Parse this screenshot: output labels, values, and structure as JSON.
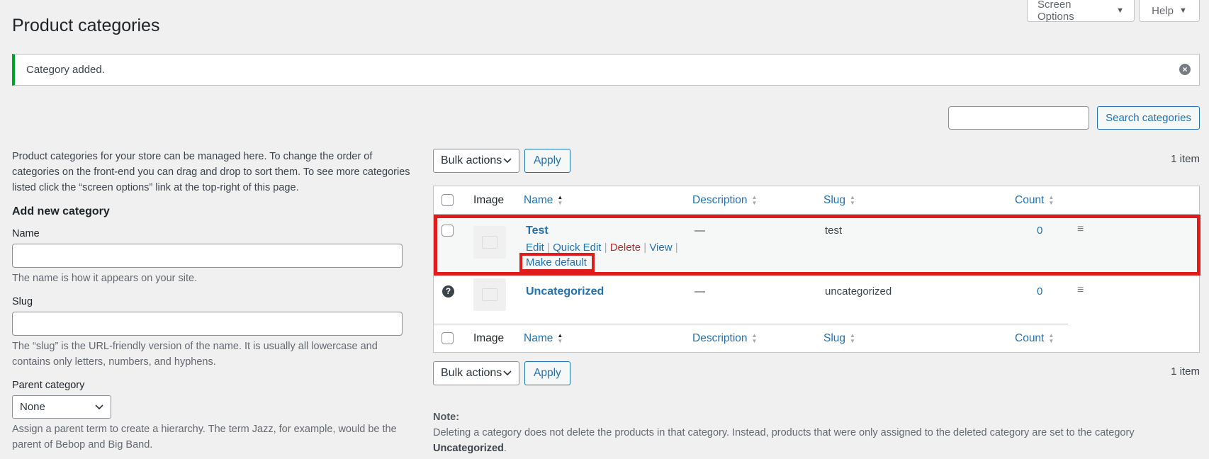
{
  "screen_options": {
    "label": "Screen Options",
    "caret": "▼"
  },
  "help": {
    "label": "Help",
    "caret": "▼"
  },
  "page_title": "Product categories",
  "notice": {
    "message": "Category added."
  },
  "search": {
    "button_label": "Search categories"
  },
  "left": {
    "description": "Product categories for your store can be managed here. To change the order of categories on the front-end you can drag and drop to sort them. To see more categories listed click the “screen options” link at the top-right of this page.",
    "add_title": "Add new category",
    "name_label": "Name",
    "name_help": "The name is how it appears on your site.",
    "slug_label": "Slug",
    "slug_help": "The “slug” is the URL-friendly version of the name. It is usually all lowercase and contains only letters, numbers, and hyphens.",
    "parent_label": "Parent category",
    "parent_value": "None",
    "parent_help": "Assign a parent term to create a hierarchy. The term Jazz, for example, would be the parent of Bebop and Big Band."
  },
  "tablenav": {
    "bulk_label": "Bulk actions",
    "apply_label": "Apply",
    "count_text": "1 item"
  },
  "columns": {
    "image": "Image",
    "name": "Name",
    "description": "Description",
    "slug": "Slug",
    "count": "Count"
  },
  "rows": [
    {
      "name": "Test",
      "description": "—",
      "slug": "test",
      "count": "0",
      "actions": {
        "edit": "Edit",
        "quick_edit": "Quick Edit",
        "delete": "Delete",
        "view": "View",
        "make_default": "Make default",
        "sep": "|"
      }
    },
    {
      "name": "Uncategorized",
      "description": "—",
      "slug": "uncategorized",
      "count": "0"
    }
  ],
  "note": {
    "title": "Note:",
    "text": "Deleting a category does not delete the products in that category. Instead, products that were only assigned to the deleted category are set to the category",
    "strong": "Uncategorized",
    "end": "."
  },
  "colors": {
    "accent": "#2271b1",
    "highlight": "#e01b1b",
    "success": "#00a32a",
    "danger": "#b32d2e"
  }
}
